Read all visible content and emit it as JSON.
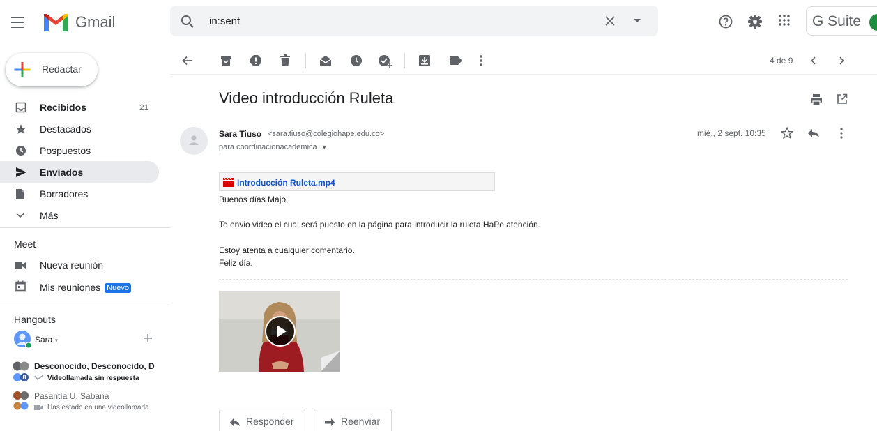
{
  "header": {
    "app_name": "Gmail",
    "search_query": "in:sent",
    "gsuite_label": "G Suite"
  },
  "sidebar": {
    "compose_label": "Redactar",
    "nav": [
      {
        "label": "Recibidos",
        "count": "21",
        "icon": "inbox-icon"
      },
      {
        "label": "Destacados",
        "icon": "star-icon"
      },
      {
        "label": "Pospuestos",
        "icon": "clock-icon"
      },
      {
        "label": "Enviados",
        "icon": "send-icon"
      },
      {
        "label": "Borradores",
        "icon": "draft-icon"
      },
      {
        "label": "Más",
        "icon": "chevron-down-icon"
      }
    ],
    "meet": {
      "title": "Meet",
      "new_meeting": "Nueva reunión",
      "my_meetings": "Mis reuniones",
      "new_badge": "Nuevo"
    },
    "hangouts": {
      "title": "Hangouts",
      "user": "Sara",
      "conversations": [
        {
          "name": "Desconocido, Desconocido, D",
          "status": "Videollamada sin respuesta",
          "count": "8"
        },
        {
          "name": "Pasantía U. Sabana",
          "status": "Has estado en una videollamada"
        }
      ]
    }
  },
  "toolbar": {
    "pager": "4 de 9"
  },
  "message": {
    "subject": "Video introducción Ruleta",
    "sender_name": "Sara Tiuso",
    "sender_email": "<sara.tiuso@colegiohape.edu.co>",
    "recipient": "para coordinacionacademica",
    "date": "mié., 2 sept. 10:35",
    "attachment_name": "Introducción Ruleta.mp4",
    "body": {
      "greeting": "Buenos días Majo,",
      "line1": "Te envio video el cual será puesto en la página para introducir la ruleta HaPe atención.",
      "line2": "Estoy atenta a cualquier comentario.",
      "line3": "Feliz día."
    }
  },
  "actions": {
    "reply": "Responder",
    "forward": "Reenviar"
  },
  "colors": {
    "accent": "#1a73e8",
    "link": "#1155cc",
    "active_nav": "#e8eaed"
  }
}
